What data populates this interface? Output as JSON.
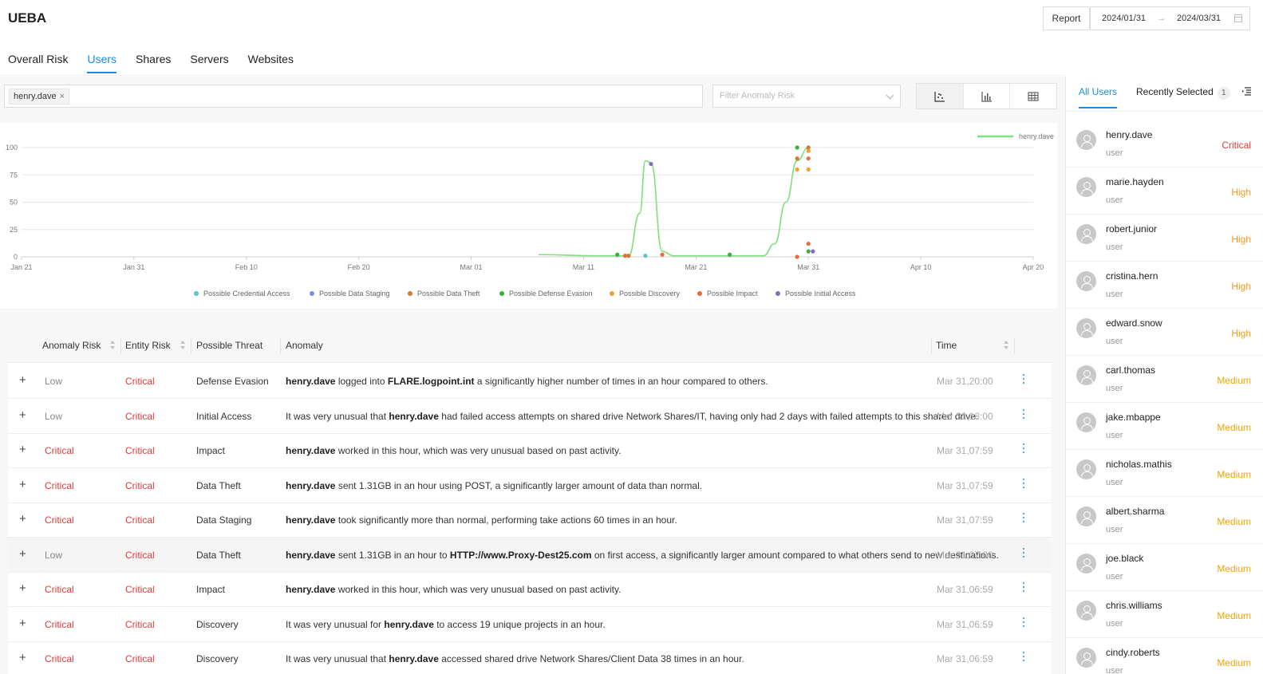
{
  "app": {
    "title": "UEBA"
  },
  "header": {
    "report_label": "Report",
    "date_from": "2024/01/31",
    "date_sep": "→",
    "date_to": "2024/03/31"
  },
  "tabs": [
    {
      "label": "Overall Risk",
      "active": false
    },
    {
      "label": "Users",
      "active": true
    },
    {
      "label": "Shares",
      "active": false
    },
    {
      "label": "Servers",
      "active": false
    },
    {
      "label": "Websites",
      "active": false
    }
  ],
  "filter": {
    "tag": "henry.dave",
    "tag_close": "×",
    "anomaly_placeholder": "Filter Anomaly Risk",
    "views": [
      "scatter-chart-icon",
      "bar-chart-icon",
      "table-grid-icon"
    ],
    "active_view": 0
  },
  "chart_data": {
    "type": "line",
    "x_ticks": [
      "Jan 21",
      "Jan 31",
      "Feb 10",
      "Feb 20",
      "Mar 01",
      "Mar 11",
      "Mar 21",
      "Mar 31",
      "Apr 10",
      "Apr 20"
    ],
    "y_ticks": [
      0,
      25,
      50,
      75,
      100
    ],
    "ylim": [
      0,
      100
    ],
    "xlim": [
      "2024-01-21",
      "2024-04-20"
    ],
    "line_series": {
      "name": "henry.dave",
      "color": "#7de07a",
      "points": [
        [
          "2024-03-07",
          2
        ],
        [
          "2024-03-12",
          1
        ],
        [
          "2024-03-15",
          1
        ],
        [
          "2024-03-16",
          40
        ],
        [
          "2024-03-16.5",
          88
        ],
        [
          "2024-03-17",
          86
        ],
        [
          "2024-03-18",
          5
        ],
        [
          "2024-03-19",
          1
        ],
        [
          "2024-03-27",
          1
        ],
        [
          "2024-03-28",
          12
        ],
        [
          "2024-03-29",
          50
        ],
        [
          "2024-03-30",
          88
        ],
        [
          "2024-03-31",
          100
        ]
      ]
    },
    "scatter_series": [
      {
        "name": "Possible Credential Access",
        "color": "#5fc4c9",
        "points": [
          [
            "2024-03-16.5",
            1
          ]
        ]
      },
      {
        "name": "Possible Data Staging",
        "color": "#6f8fe8",
        "points": []
      },
      {
        "name": "Possible Data Theft",
        "color": "#d17a2a",
        "points": [
          [
            "2024-03-15",
            1
          ],
          [
            "2024-03-30",
            90
          ],
          [
            "2024-03-31",
            100
          ]
        ]
      },
      {
        "name": "Possible Defense Evasion",
        "color": "#3fae3f",
        "points": [
          [
            "2024-03-14",
            2
          ],
          [
            "2024-03-24",
            2
          ],
          [
            "2024-03-30",
            100
          ],
          [
            "2024-03-31",
            5
          ]
        ]
      },
      {
        "name": "Possible Discovery",
        "color": "#f2a030",
        "points": [
          [
            "2024-03-30",
            80
          ],
          [
            "2024-03-31",
            80
          ],
          [
            "2024-03-31",
            97
          ]
        ]
      },
      {
        "name": "Possible Impact",
        "color": "#ec6a3d",
        "points": [
          [
            "2024-03-14.7",
            1
          ],
          [
            "2024-03-18",
            2
          ],
          [
            "2024-03-30",
            0
          ],
          [
            "2024-03-31",
            90
          ],
          [
            "2024-03-31",
            12
          ]
        ]
      },
      {
        "name": "Possible Initial Access",
        "color": "#8a6bb8",
        "points": [
          [
            "2024-03-17",
            85
          ],
          [
            "2024-03-31.4",
            5
          ]
        ]
      }
    ]
  },
  "table": {
    "columns": [
      "Anomaly Risk",
      "Entity Risk",
      "Possible Threat",
      "Anomaly",
      "Time"
    ],
    "rows": [
      {
        "anomaly_risk": "Low",
        "entity_risk": "Critical",
        "threat": "Defense Evasion",
        "anomaly": [
          [
            "b",
            "henry.dave"
          ],
          [
            "t",
            " logged into "
          ],
          [
            "b",
            "FLARE.logpoint.int"
          ],
          [
            "t",
            " a significantly higher number of times in an hour compared to others."
          ]
        ],
        "time": "Mar 31,20:00"
      },
      {
        "anomaly_risk": "Low",
        "entity_risk": "Critical",
        "threat": "Initial Access",
        "anomaly": [
          [
            "t",
            "It was very unusual that "
          ],
          [
            "b",
            "henry.dave"
          ],
          [
            "t",
            " had failed access attempts on shared drive Network Shares/IT, having only had 2 days with failed attempts to this shared drive."
          ]
        ],
        "time": "Mar 31,18:00"
      },
      {
        "anomaly_risk": "Critical",
        "entity_risk": "Critical",
        "threat": "Impact",
        "anomaly": [
          [
            "b",
            "henry.dave"
          ],
          [
            "t",
            " worked in this hour, which was very unusual based on past activity."
          ]
        ],
        "time": "Mar 31,07:59"
      },
      {
        "anomaly_risk": "Critical",
        "entity_risk": "Critical",
        "threat": "Data Theft",
        "anomaly": [
          [
            "b",
            "henry.dave"
          ],
          [
            "t",
            " sent 1.31GB in an hour using POST, a significantly larger amount of data than normal."
          ]
        ],
        "time": "Mar 31,07:59"
      },
      {
        "anomaly_risk": "Critical",
        "entity_risk": "Critical",
        "threat": "Data Staging",
        "anomaly": [
          [
            "b",
            "henry.dave"
          ],
          [
            "t",
            " took significantly more than normal, performing take actions 60 times in an hour."
          ]
        ],
        "time": "Mar 31,07:59"
      },
      {
        "anomaly_risk": "Low",
        "entity_risk": "Critical",
        "threat": "Data Theft",
        "anomaly": [
          [
            "b",
            "henry.dave"
          ],
          [
            "t",
            " sent 1.31GB in an hour to "
          ],
          [
            "b",
            "HTTP://www.Proxy-Dest25.com"
          ],
          [
            "t",
            " on first access, a significantly larger amount compared to what others send to new destinations."
          ]
        ],
        "time": "Mar 31,07:00",
        "highlight": true
      },
      {
        "anomaly_risk": "Critical",
        "entity_risk": "Critical",
        "threat": "Impact",
        "anomaly": [
          [
            "b",
            "henry.dave"
          ],
          [
            "t",
            " worked in this hour, which was very unusual based on past activity."
          ]
        ],
        "time": "Mar 31,06:59"
      },
      {
        "anomaly_risk": "Critical",
        "entity_risk": "Critical",
        "threat": "Discovery",
        "anomaly": [
          [
            "t",
            "It was very unusual for "
          ],
          [
            "b",
            "henry.dave"
          ],
          [
            "t",
            " to access 19 unique projects in an hour."
          ]
        ],
        "time": "Mar 31,06:59"
      },
      {
        "anomaly_risk": "Critical",
        "entity_risk": "Critical",
        "threat": "Discovery",
        "anomaly": [
          [
            "t",
            "It was very unusual that "
          ],
          [
            "b",
            "henry.dave"
          ],
          [
            "t",
            " accessed shared drive Network Shares/Client Data 38 times in an hour."
          ]
        ],
        "time": "Mar 31,06:59"
      }
    ]
  },
  "right_panel": {
    "tabs": [
      {
        "label": "All Users",
        "active": true
      },
      {
        "label": "Recently Selected",
        "count": "1",
        "active": false
      }
    ],
    "users": [
      {
        "name": "henry.dave",
        "role": "user",
        "risk": "Critical"
      },
      {
        "name": "marie.hayden",
        "role": "user",
        "risk": "High"
      },
      {
        "name": "robert.junior",
        "role": "user",
        "risk": "High"
      },
      {
        "name": "cristina.hern",
        "role": "user",
        "risk": "High"
      },
      {
        "name": "edward.snow",
        "role": "user",
        "risk": "High"
      },
      {
        "name": "carl.thomas",
        "role": "user",
        "risk": "Medium"
      },
      {
        "name": "jake.mbappe",
        "role": "user",
        "risk": "Medium"
      },
      {
        "name": "nicholas.mathis",
        "role": "user",
        "risk": "Medium"
      },
      {
        "name": "albert.sharma",
        "role": "user",
        "risk": "Medium"
      },
      {
        "name": "joe.black",
        "role": "user",
        "risk": "Medium"
      },
      {
        "name": "chris.williams",
        "role": "user",
        "risk": "Medium"
      },
      {
        "name": "cindy.roberts",
        "role": "user",
        "risk": "Medium"
      }
    ]
  }
}
